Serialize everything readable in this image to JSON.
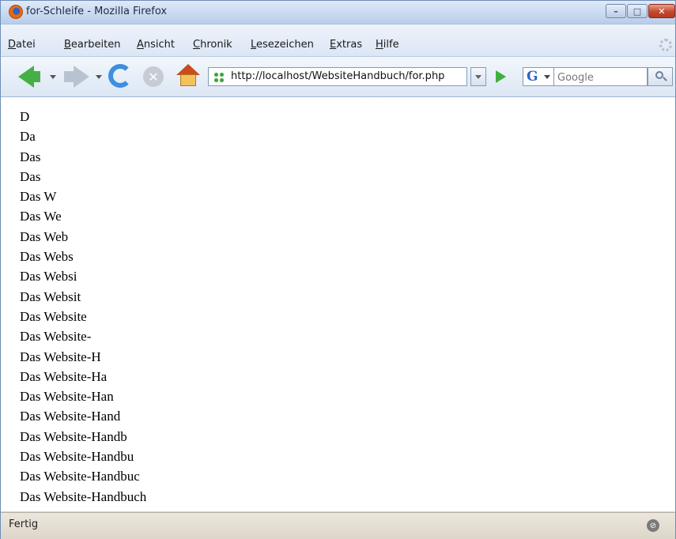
{
  "window": {
    "title": "for-Schleife - Mozilla Firefox",
    "controls": {
      "minimize": "–",
      "maximize": "□",
      "close": "✕"
    }
  },
  "menu": {
    "items": [
      "Datei",
      "Bearbeiten",
      "Ansicht",
      "Chronik",
      "Lesezeichen",
      "Extras",
      "Hilfe"
    ]
  },
  "toolbar": {
    "url": "http://localhost/WebsiteHandbuch/for.php",
    "search_engine": "G",
    "search_placeholder": "Google"
  },
  "content": {
    "lines": [
      "D",
      "Da",
      "Das",
      "Das",
      "Das W",
      "Das We",
      "Das Web",
      "Das Webs",
      "Das Websi",
      "Das Websit",
      "Das Website",
      "Das Website-",
      "Das Website-H",
      "Das Website-Ha",
      "Das Website-Han",
      "Das Website-Hand",
      "Das Website-Handb",
      "Das Website-Handbu",
      "Das Website-Handbuc",
      "Das Website-Handbuch"
    ]
  },
  "status": {
    "text": "Fertig"
  },
  "colors": {
    "title_bar": "#c9daf1",
    "accent_green": "#46b046",
    "reload_blue": "#3d8fe0",
    "close_red": "#c6482d"
  }
}
